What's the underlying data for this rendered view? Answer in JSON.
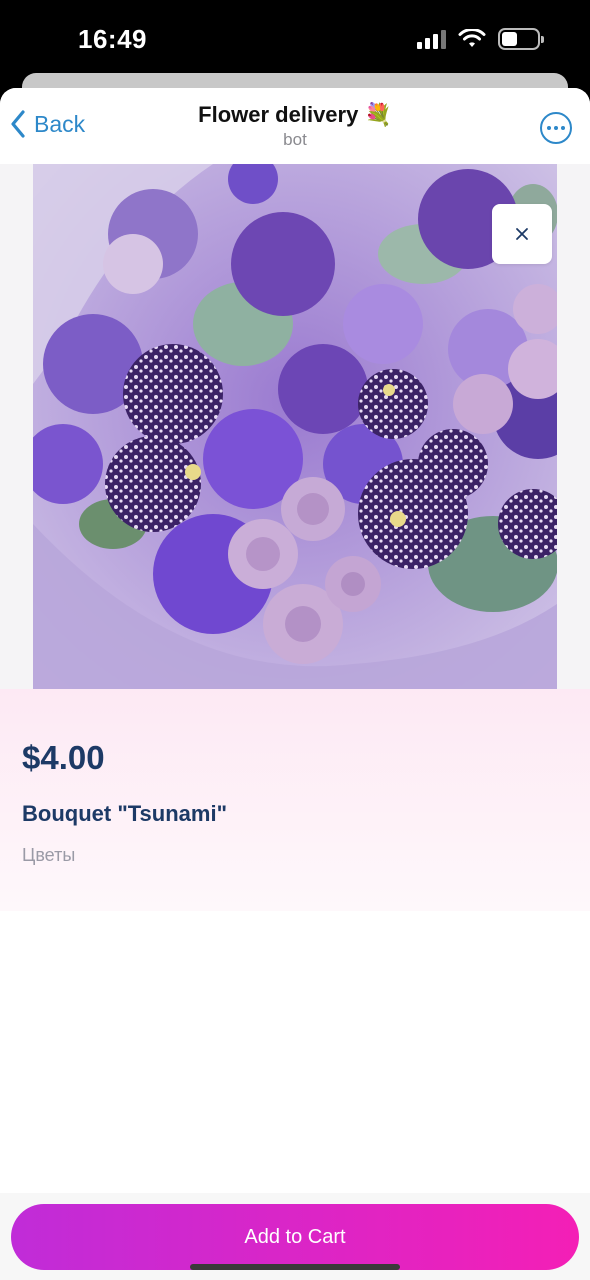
{
  "status_bar": {
    "time": "16:49",
    "battery_level": 0.45
  },
  "nav": {
    "back_label": "Back",
    "title": "Flower delivery 💐",
    "subtitle": "bot"
  },
  "product": {
    "price": "$4.00",
    "name": "Bouquet \"Tsunami\"",
    "category": "Цветы"
  },
  "actions": {
    "add_to_cart_label": "Add to Cart"
  },
  "colors": {
    "accent": "#2d88c9",
    "price_text": "#1d3a66",
    "button_gradient_start": "#c02cd8",
    "button_gradient_end": "#f41fb6"
  },
  "icons": {
    "back": "chevron-left-icon",
    "more": "more-horizontal-icon",
    "close": "close-icon"
  }
}
